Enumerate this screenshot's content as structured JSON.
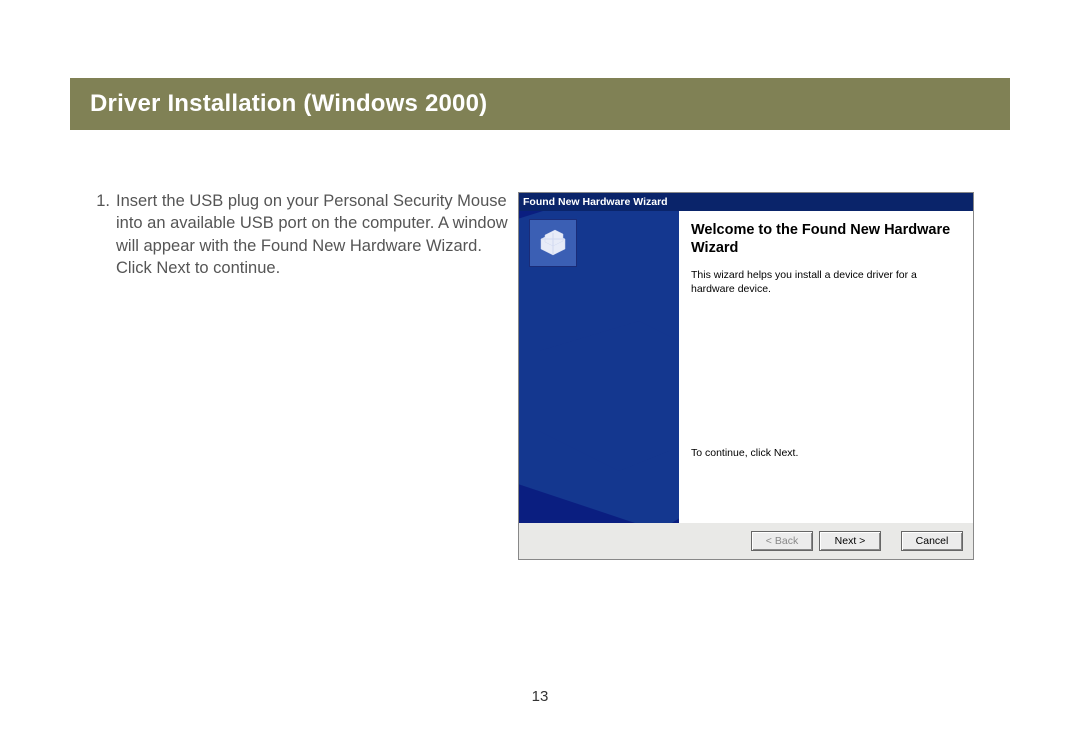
{
  "banner": {
    "title": "Driver Installation (Windows 2000)"
  },
  "steps": [
    {
      "num": "1.",
      "text": "Insert the USB plug on your Personal Security Mouse into an available USB port on the computer.  A window will appear with the Found New Hardware Wizard.  Click Next to continue."
    }
  ],
  "wizard": {
    "titlebar": "Found New Hardware Wizard",
    "heading": "Welcome to the Found New Hardware Wizard",
    "desc": "This wizard helps you install a device driver for a hardware device.",
    "continue": "To continue, click Next.",
    "buttons": {
      "back": "< Back",
      "next": "Next >",
      "cancel": "Cancel"
    }
  },
  "page_number": "13"
}
